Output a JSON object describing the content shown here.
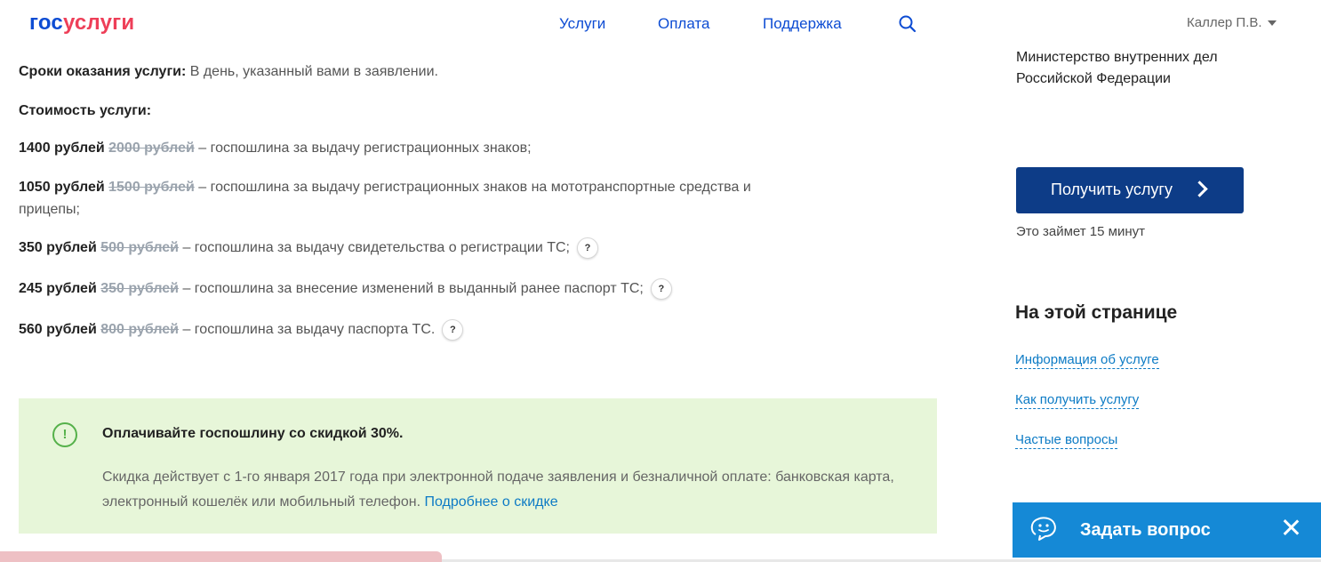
{
  "header": {
    "logo_part1": "гос",
    "logo_part2": "услуги",
    "nav": [
      "Услуги",
      "Оплата",
      "Поддержка"
    ],
    "user_name": "Каллер П.В."
  },
  "main": {
    "term_label": "Сроки оказания услуги:",
    "term_text": " В день, указанный вами в заявлении.",
    "cost_title": "Стоимость услуги:",
    "prices": [
      {
        "new": "1400 рублей",
        "old": "2000 рублей",
        "text": " – госпошлина за выдачу регистрационных знаков;",
        "text2": "",
        "help": ""
      },
      {
        "new": "1050 рублей",
        "old": "1500 рублей",
        "text": " – госпошлина за выдачу регистрационных знаков на мототранспортные средства и",
        "text2": "прицепы;",
        "help": ""
      },
      {
        "new": "350 рублей",
        "old": "500 рублей",
        "text": " – госпошлина за выдачу свидетельства о регистрации ТС;",
        "text2": "",
        "help": "?"
      },
      {
        "new": "245 рублей",
        "old": "350 рублей",
        "text": " – госпошлина за внесение изменений в выданный ранее паспорт ТС;",
        "text2": "",
        "help": "?"
      },
      {
        "new": "560 рублей",
        "old": "800 рублей",
        "text": " – госпошлина за выдачу паспорта ТС.",
        "text2": "",
        "help": "?"
      }
    ]
  },
  "notice": {
    "icon": "!",
    "title": "Оплачивайте госпошлину со скидкой 30%.",
    "body": "Скидка действует с 1-го января 2017 года при электронной подаче заявления и безналичной оплате: банковская карта, электронный кошелёк или мобильный телефон.",
    "link": "Подробнее о скидке"
  },
  "sidebar": {
    "ministry": "Министерство внутренних дел Российской Федерации",
    "get_button": "Получить услугу",
    "time_note": "Это займет 15 минут",
    "toc_title": "На этой странице",
    "toc_links": [
      "Информация об услуге",
      "Как получить услугу",
      "Частые вопросы"
    ]
  },
  "ask_widget": {
    "label": "Задать вопрос"
  },
  "colors": {
    "brand_blue": "#0d4cd3",
    "brand_red": "#ee3f58",
    "button_blue": "#0d3c87",
    "notice_green": "#e7f6d9",
    "widget_blue": "#1589d6"
  }
}
